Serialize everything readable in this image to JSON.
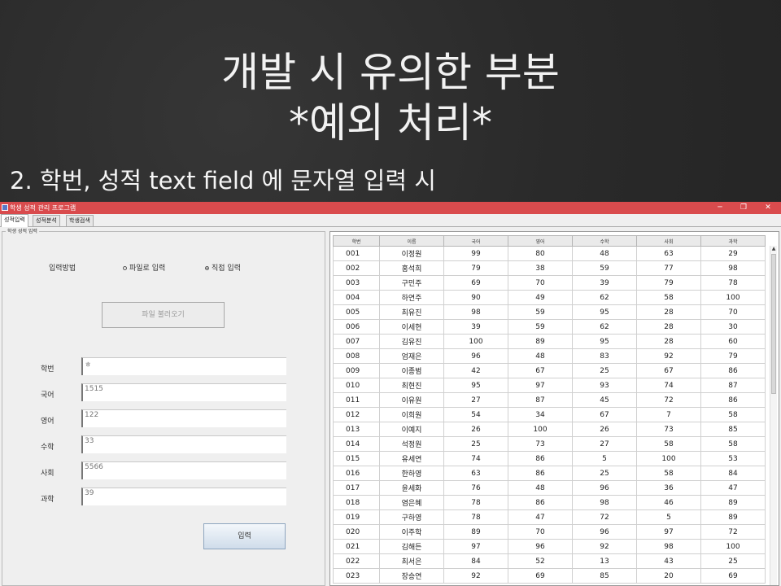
{
  "slide": {
    "title_line1": "개발 시 유의한 부분",
    "title_line2": "*예외 처리*",
    "subtitle": "2. 학번, 성적 text field 에 문자열 입력 시"
  },
  "window": {
    "title": "학생 성적 관리 프로그램",
    "minimize": "─",
    "restore": "❐",
    "close": "✕",
    "titlebar_color": "#d94b4d"
  },
  "tabs": [
    "성적입력",
    "성적분석",
    "학생검색"
  ],
  "form": {
    "legend": "학생 성적 입력",
    "input_method_label": "입력방법",
    "radio_file": "파일로 입력",
    "radio_direct": "직접 입력",
    "selected_radio": "직접 입력",
    "load_file_button": "파일 불러오기",
    "fields": [
      {
        "label": "학번",
        "value": "ㅎ"
      },
      {
        "label": "국어",
        "value": "1515"
      },
      {
        "label": "영어",
        "value": "122"
      },
      {
        "label": "수학",
        "value": "33"
      },
      {
        "label": "사회",
        "value": "5566"
      },
      {
        "label": "과학",
        "value": "39"
      }
    ],
    "submit_button": "입력"
  },
  "table": {
    "headers": [
      "학번",
      "이름",
      "국어",
      "영어",
      "수학",
      "사회",
      "과학"
    ],
    "rows": [
      [
        "001",
        "이정원",
        "99",
        "80",
        "48",
        "63",
        "29"
      ],
      [
        "002",
        "홍석희",
        "79",
        "38",
        "59",
        "77",
        "98"
      ],
      [
        "003",
        "구민주",
        "69",
        "70",
        "39",
        "79",
        "78"
      ],
      [
        "004",
        "하연주",
        "90",
        "49",
        "62",
        "58",
        "100"
      ],
      [
        "005",
        "최유진",
        "98",
        "59",
        "95",
        "28",
        "70"
      ],
      [
        "006",
        "이세현",
        "39",
        "59",
        "62",
        "28",
        "30"
      ],
      [
        "007",
        "김유진",
        "100",
        "89",
        "95",
        "28",
        "60"
      ],
      [
        "008",
        "엄재은",
        "96",
        "48",
        "83",
        "92",
        "79"
      ],
      [
        "009",
        "이종범",
        "42",
        "67",
        "25",
        "67",
        "86"
      ],
      [
        "010",
        "최현진",
        "95",
        "97",
        "93",
        "74",
        "87"
      ],
      [
        "011",
        "이유원",
        "27",
        "87",
        "45",
        "72",
        "86"
      ],
      [
        "012",
        "이희원",
        "54",
        "34",
        "67",
        "7",
        "58"
      ],
      [
        "013",
        "이예지",
        "26",
        "100",
        "26",
        "73",
        "85"
      ],
      [
        "014",
        "석정원",
        "25",
        "73",
        "27",
        "58",
        "58"
      ],
      [
        "015",
        "유세연",
        "74",
        "86",
        "5",
        "100",
        "53"
      ],
      [
        "016",
        "한하영",
        "63",
        "86",
        "25",
        "58",
        "84"
      ],
      [
        "017",
        "윤세화",
        "76",
        "48",
        "96",
        "36",
        "47"
      ],
      [
        "018",
        "염은혜",
        "78",
        "86",
        "98",
        "46",
        "89"
      ],
      [
        "019",
        "구하영",
        "78",
        "47",
        "72",
        "5",
        "89"
      ],
      [
        "020",
        "이주학",
        "89",
        "70",
        "96",
        "97",
        "72"
      ],
      [
        "021",
        "김해든",
        "97",
        "96",
        "92",
        "98",
        "100"
      ],
      [
        "022",
        "최서은",
        "84",
        "52",
        "13",
        "43",
        "25"
      ],
      [
        "023",
        "장승연",
        "92",
        "69",
        "85",
        "20",
        "69"
      ]
    ]
  }
}
